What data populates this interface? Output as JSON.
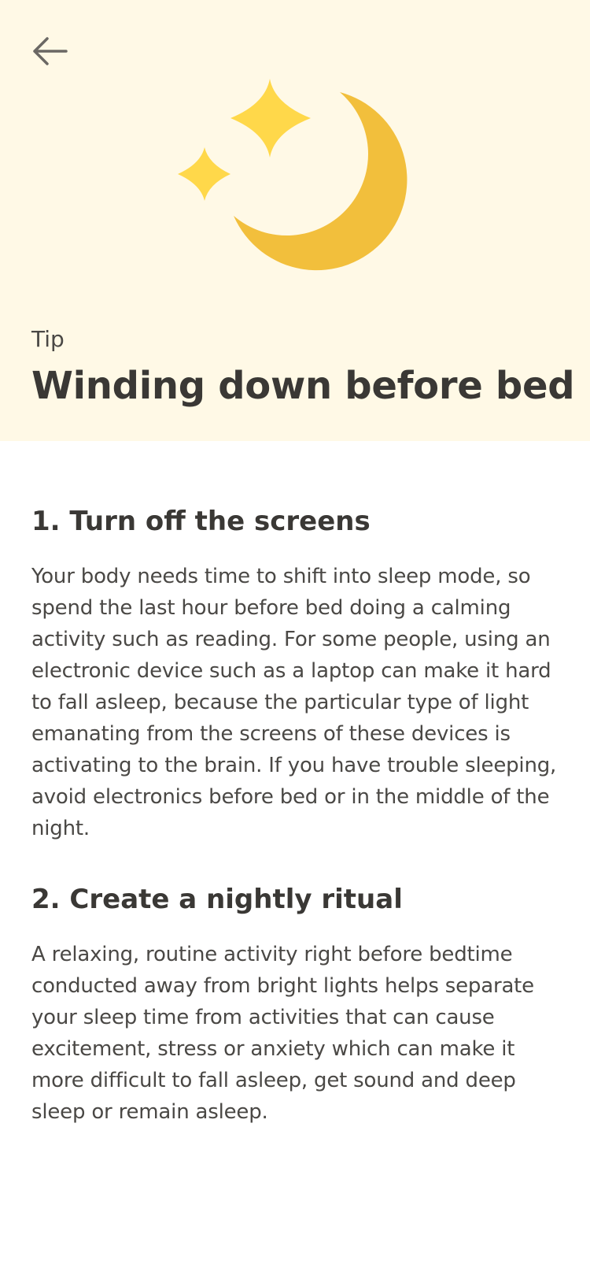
{
  "header": {
    "back_icon": "arrow-left-icon",
    "illustration_icon": "moon-and-stars-icon",
    "eyebrow": "Tip",
    "title": "Winding down before bed",
    "colors": {
      "background": "#fff9e6",
      "moon": "#f2bf3c",
      "stars": "#ffd84a"
    }
  },
  "sections": [
    {
      "heading": "1. Turn off the screens",
      "body": "Your body needs time to shift into sleep mode, so spend the last hour before bed doing a calming activity such as reading. For some people, using an electronic device such as a laptop can make it hard to fall asleep, because the particular type of light emanating from the screens of these devices is activating to the brain. If you have trouble sleeping, avoid electronics before bed or in the middle of the night."
    },
    {
      "heading": "2. Create a nightly ritual",
      "body": "A relaxing, routine activity right before bedtime conducted away from bright lights helps separate your sleep time from activities that can cause excitement, stress or anxiety which can make it more difficult to fall asleep, get sound and deep sleep or remain asleep."
    }
  ]
}
